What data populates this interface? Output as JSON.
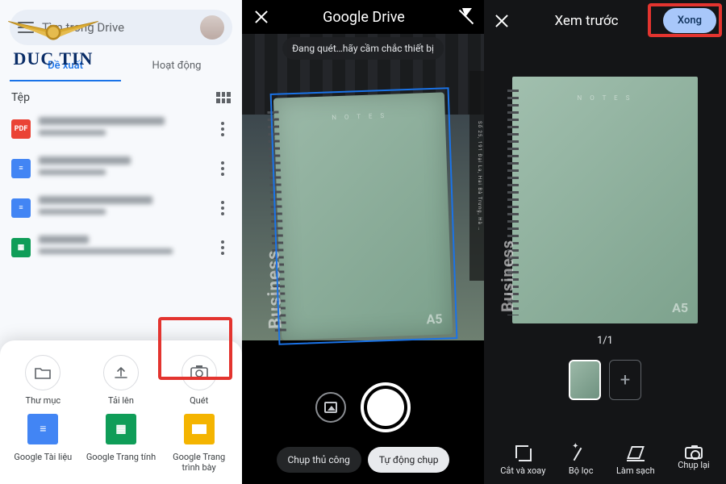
{
  "panel1": {
    "search_placeholder": "Tìm trong Drive",
    "tabs": {
      "suggested": "Đề xuất",
      "activity": "Hoạt động"
    },
    "section_label": "Tệp",
    "sheet": {
      "folder": "Thư mục",
      "upload": "Tải lên",
      "scan": "Quét",
      "docs": "Google Tài liệu",
      "sheets": "Google Trang tính",
      "slides": "Google Trang trình bày"
    }
  },
  "watermark": {
    "brand": "DUC TIN"
  },
  "panel2": {
    "title": "Google Drive",
    "toast": "Đang quét…hãy cầm chắc thiết bị",
    "ruler_text": "Số 25, 191 Đại La, Hai Bà Trưng, Hà …",
    "notebook": {
      "side": "Business",
      "size": "A5",
      "title": "N O T E S"
    },
    "chips": {
      "manual": "Chụp thủ công",
      "auto": "Tự động chụp"
    }
  },
  "panel3": {
    "title": "Xem trước",
    "done": "Xong",
    "counter": "1/1",
    "notebook": {
      "side": "Business",
      "size": "A5",
      "title": "N O T E S"
    },
    "tools": {
      "crop": "Cắt và xoay",
      "filter": "Bộ lọc",
      "clean": "Làm sạch",
      "retake": "Chụp lại"
    }
  }
}
